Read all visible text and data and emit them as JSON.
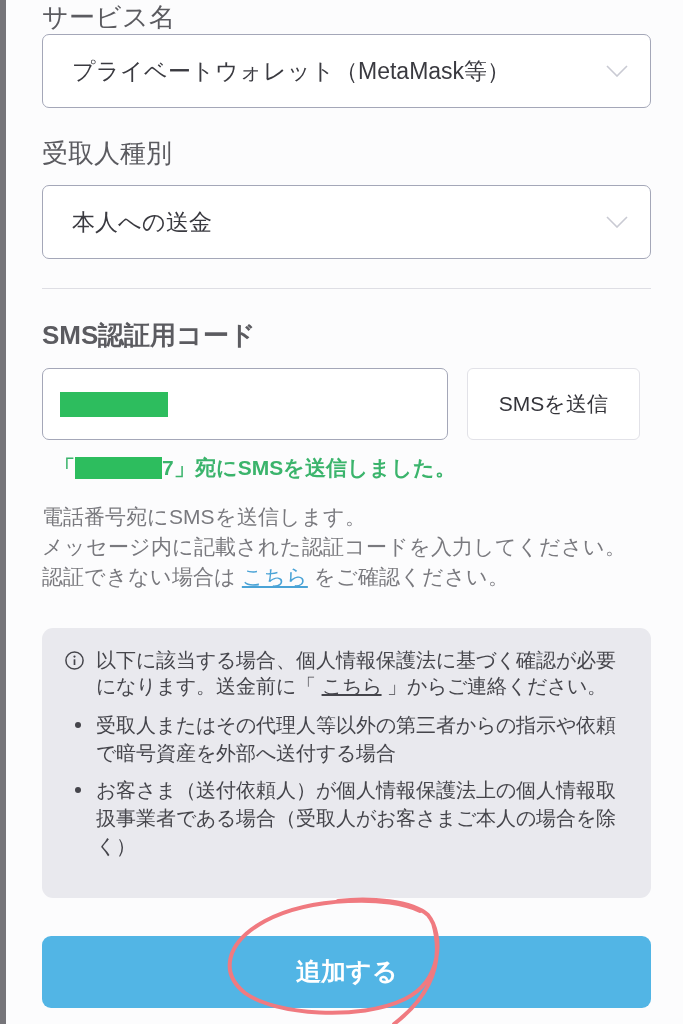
{
  "selects": [
    {
      "label": "サービス名",
      "value": "プライベートウォレット（MetaMask等）"
    },
    {
      "label": "受取人種別",
      "value": "本人への送金"
    }
  ],
  "sms_code": {
    "label": "SMS認証用コード",
    "send_button": "SMSを送信",
    "sent_notice": {
      "before": "「",
      "after": "7」宛にSMSを送信しました。"
    }
  },
  "help_text": {
    "lines": [
      "電話番号宛にSMSを送信します。",
      "メッセージ内に記載された認証コードを入力してください。"
    ],
    "last_line": {
      "before": "認証できない場合は ",
      "link": "こちら",
      "after": " をご確認ください。"
    }
  },
  "notice_box": {
    "intro": {
      "before": "以下に該当する場合、個人情報保護法に基づく確認が必要になります。送金前に「 ",
      "link": "こちら",
      "after": " 」からご連絡ください。"
    },
    "items": [
      "受取人またはその代理人等以外の第三者からの指示や依頼で暗号資産を外部へ送付する場合",
      "お客さま（送付依頼人）が個人情報保護法上の個人情報取扱事業者である場合（受取人がお客さまご本人の場合を除く）"
    ]
  },
  "submit_button": "追加する"
}
